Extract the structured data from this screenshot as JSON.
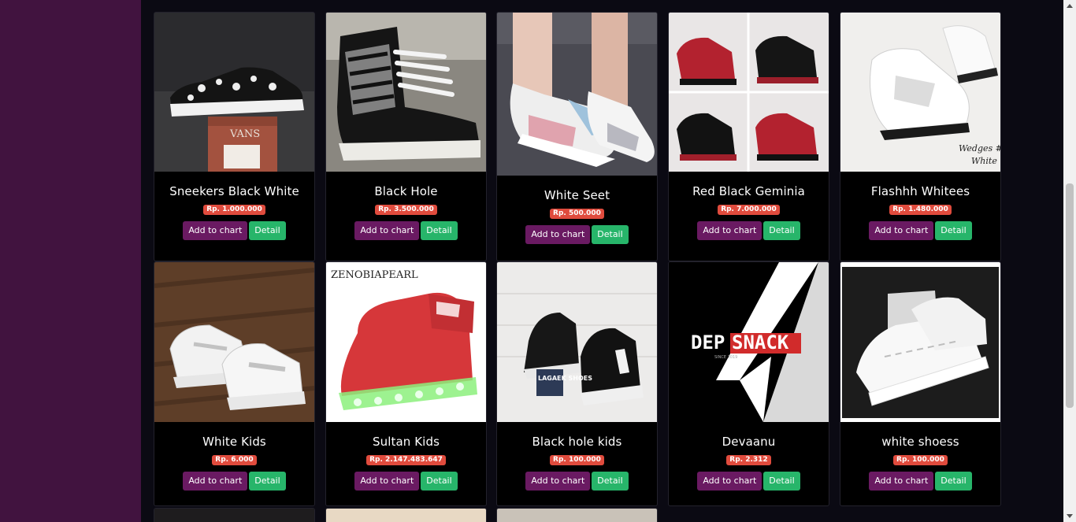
{
  "products": [
    {
      "name": "Sneekers Black White",
      "price": "Rp. 1.000.000",
      "add_label": "Add to chart",
      "detail_label": "Detail"
    },
    {
      "name": "Black Hole",
      "price": "Rp. 3.500.000",
      "add_label": "Add to chart",
      "detail_label": "Detail"
    },
    {
      "name": "White Seet",
      "price": "Rp. 500.000",
      "add_label": "Add to chart",
      "detail_label": "Detail"
    },
    {
      "name": "Red Black Geminia",
      "price": "Rp. 7.000.000",
      "add_label": "Add to chart",
      "detail_label": "Detail"
    },
    {
      "name": "Flashhh Whitees",
      "price": "Rp. 1.480.000",
      "add_label": "Add to chart",
      "detail_label": "Detail"
    },
    {
      "name": "White Kids",
      "price": "Rp. 6.000",
      "add_label": "Add to chart",
      "detail_label": "Detail"
    },
    {
      "name": "Sultan Kids",
      "price": "Rp. 2.147.483.647",
      "add_label": "Add to chart",
      "detail_label": "Detail"
    },
    {
      "name": "Black hole kids",
      "price": "Rp. 100.000",
      "add_label": "Add to chart",
      "detail_label": "Detail"
    },
    {
      "name": "Devaanu",
      "price": "Rp. 2.312",
      "add_label": "Add to chart",
      "detail_label": "Detail"
    },
    {
      "name": "white shoess",
      "price": "Rp. 100.000",
      "add_label": "Add to chart",
      "detail_label": "Detail"
    }
  ],
  "image_text": {
    "zenobia": "ZENOBIAPEARL",
    "lagaek": "LAGAEK SHOES",
    "dep": "DEP",
    "snack": "SNACK",
    "since": "SINCE 2019",
    "vans": "VANS",
    "wedges": "Wedges #",
    "white": "White"
  },
  "colors": {
    "sidebar": "#41133f",
    "page_bg": "#0b0a13",
    "card_bg": "#000000",
    "price_badge": "#e04b3d",
    "add_button": "#6a1a62",
    "detail_button": "#27b56a"
  }
}
